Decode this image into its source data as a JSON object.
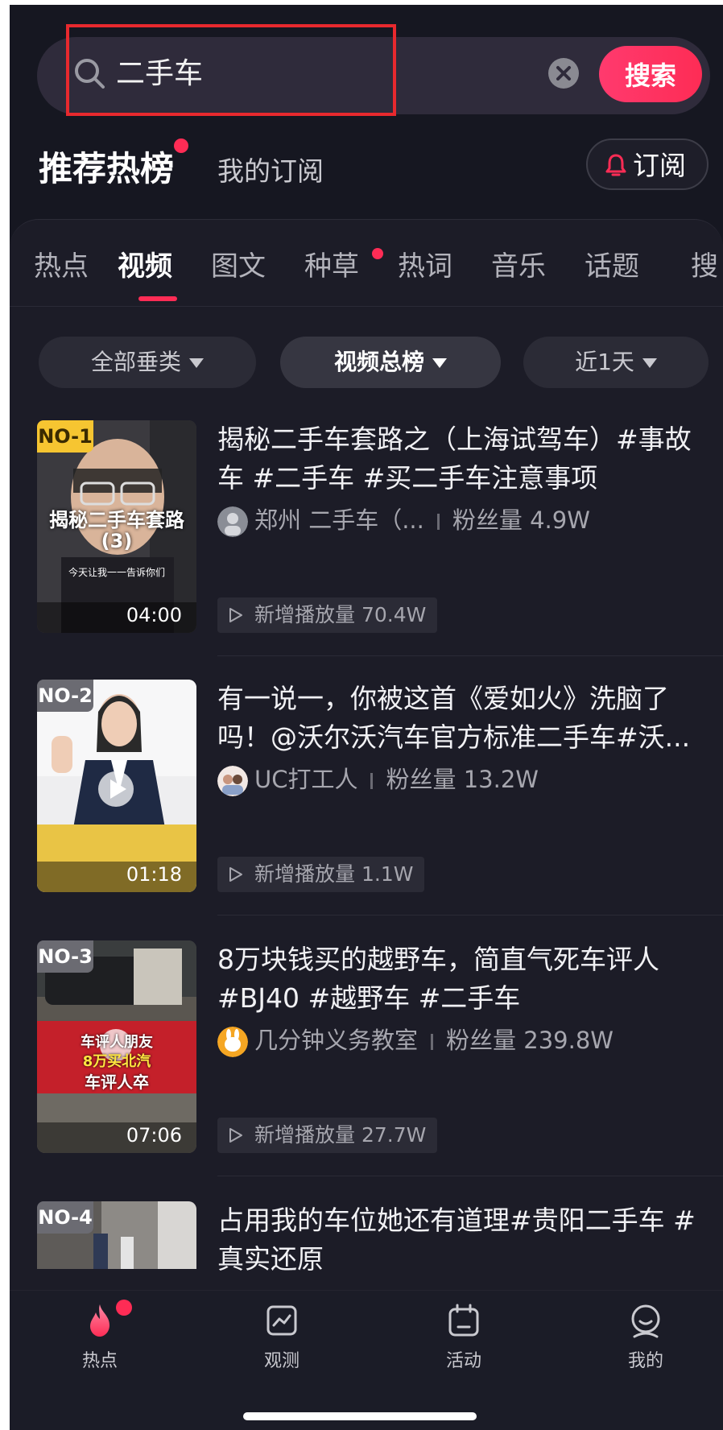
{
  "search": {
    "query": "二手车",
    "button_label": "搜索"
  },
  "header": {
    "hot_title": "推荐热榜",
    "subscriptions_tab": "我的订阅",
    "subscribe_label": "订阅"
  },
  "categories": [
    "热点",
    "视频",
    "图文",
    "种草",
    "热词",
    "音乐",
    "话题",
    "搜"
  ],
  "active_category": "视频",
  "filters": [
    "全部垂类",
    "视频总榜",
    "近1天"
  ],
  "items": [
    {
      "rank": "NO-1",
      "duration": "04:00",
      "thumb_caption": "揭秘二手车套路",
      "thumb_caption2": "(3)",
      "thumb_caption3": "今天让我一一告诉你们",
      "title": "揭秘二手车套路之（上海试驾车）#事故车 #二手车 #买二手车注意事项",
      "author": "郑州 二手车（...",
      "fans_label": "粉丝量",
      "fans": "4.9W",
      "plays_label": "新增播放量",
      "plays": "70.4W"
    },
    {
      "rank": "NO-2",
      "duration": "01:18",
      "title": "有一说一，你被这首《爱如火》洗脑了吗！@沃尔沃汽车官方标准二手车#沃...",
      "author": "UC打工人",
      "fans_label": "粉丝量",
      "fans": "13.2W",
      "plays_label": "新增播放量",
      "plays": "1.1W"
    },
    {
      "rank": "NO-3",
      "duration": "07:06",
      "thumb_caption": "车评人朋友",
      "thumb_caption2": "8万买北汽",
      "thumb_caption3": "车评人卒",
      "title": "8万块钱买的越野车，简直气死车评人#BJ40 #越野车 #二手车",
      "author": "几分钟义务教室",
      "fans_label": "粉丝量",
      "fans": "239.8W",
      "plays_label": "新增播放量",
      "plays": "27.7W"
    },
    {
      "rank": "NO-4",
      "title": "占用我的车位她还有道理#贵阳二手车 #真实还原"
    }
  ],
  "nav": [
    "热点",
    "观测",
    "活动",
    "我的"
  ],
  "colors": {
    "accent": "#fe2c55",
    "background": "#161721",
    "rank1": "#f6c531",
    "rank_other": "#6b6b72"
  }
}
